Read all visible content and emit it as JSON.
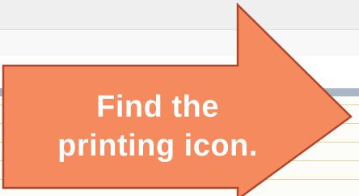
{
  "callout": {
    "line1": "Find the",
    "line2": "printing icon."
  },
  "colors": {
    "arrow_fill": "#F58A5E",
    "arrow_stroke": "#B0462C",
    "text": "#FFFFFF"
  }
}
